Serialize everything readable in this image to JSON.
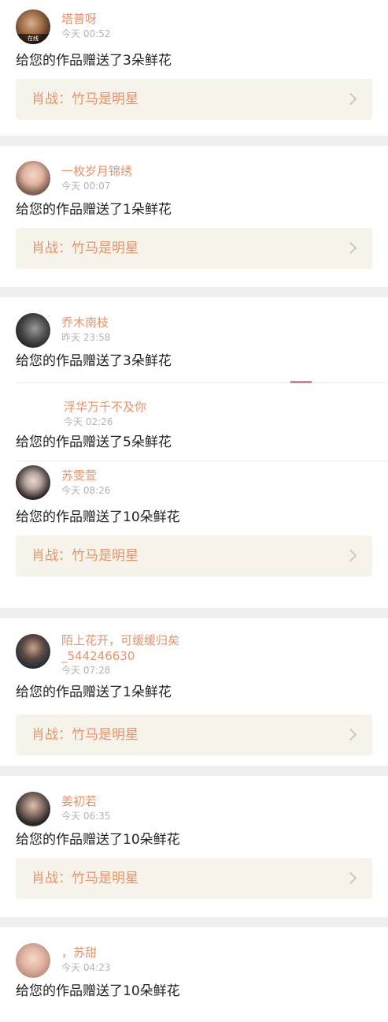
{
  "entries": [
    {
      "name": "塔普呀",
      "time": "今天 00:52",
      "message": "给您的作品赠送了3朵鲜花",
      "link": "肖战：竹马是明星",
      "avatar_caption": "在线"
    },
    {
      "name": "一枚岁月锦绣",
      "time": "今天 00:07",
      "message": "给您的作品赠送了1朵鲜花",
      "link": "肖战：竹马是明星"
    },
    {
      "name": "乔木南枝",
      "time": "昨天 23:58",
      "message": "给您的作品赠送了3朵鲜花"
    },
    {
      "name": "浮华万千不及你",
      "time": "今天 02:26",
      "message": "给您的作品赠送了5朵鲜花"
    },
    {
      "name": "苏雯萱",
      "time": "今天 08:26",
      "message": "给您的作品赠送了10朵鲜花",
      "link": "肖战：竹马是明星"
    },
    {
      "name_line1": "陌上花开，可缓缓归矣",
      "name_line2": "_544246630",
      "time": "今天 07:28",
      "message": "给您的作品赠送了1朵鲜花",
      "link": "肖战：竹马是明星"
    },
    {
      "name": "姜初若",
      "time": "今天 06:35",
      "message": "给您的作品赠送了10朵鲜花",
      "link": "肖战：竹马是明星"
    },
    {
      "name": "，苏甜",
      "time": "今天 04:23",
      "message": "给您的作品赠送了10朵鲜花"
    }
  ],
  "colors": {
    "name": "#e6936b",
    "time": "#b3b3b3",
    "link_bg": "#f6f4ea",
    "page_bg": "#efefef",
    "accent_pink": "#d87aa1"
  },
  "icons": {
    "link_arrow": "chevron-right-icon"
  }
}
